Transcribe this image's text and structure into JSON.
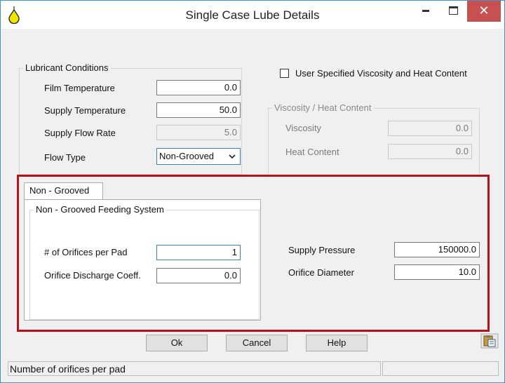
{
  "window": {
    "title": "Single Case Lube Details",
    "close_glyph": "✕"
  },
  "lubricant_conditions": {
    "group_title": "Lubricant Conditions",
    "film_temperature": {
      "label": "Film Temperature",
      "value": "0.0"
    },
    "supply_temperature": {
      "label": "Supply Temperature",
      "value": "50.0"
    },
    "supply_flow_rate": {
      "label": "Supply Flow Rate",
      "value": "5.0"
    },
    "flow_type": {
      "label": "Flow Type",
      "value": "Non-Grooved"
    }
  },
  "viscosity": {
    "checkbox_label": "User Specified Viscosity and Heat Content",
    "checked": false,
    "group_title": "Viscosity / Heat Content",
    "viscosity": {
      "label": "Viscosity",
      "value": "0.0"
    },
    "heat_content": {
      "label": "Heat Content",
      "value": "0.0"
    }
  },
  "non_grooved": {
    "tab_label": "Non - Grooved",
    "group_title": "Non - Grooved Feeding System",
    "orifices_per_pad": {
      "label": "# of Orifices per Pad",
      "value": "1"
    },
    "orifice_discharge_coeff": {
      "label": "Orifice Discharge Coeff.",
      "value": "0.0"
    },
    "supply_pressure": {
      "label": "Supply Pressure",
      "value": "150000.0"
    },
    "orifice_diameter": {
      "label": "Orifice Diameter",
      "value": "10.0"
    }
  },
  "buttons": {
    "ok": "Ok",
    "cancel": "Cancel",
    "help": "Help"
  },
  "status": {
    "message": "Number of orifices per pad",
    "secondary": ""
  },
  "colors": {
    "highlight": "#b5121b",
    "close_button": "#c75050",
    "window_border": "#3f95c9"
  },
  "icons": {
    "app": "oil-drop-icon",
    "clipboard": "clipboard-paste-icon"
  }
}
